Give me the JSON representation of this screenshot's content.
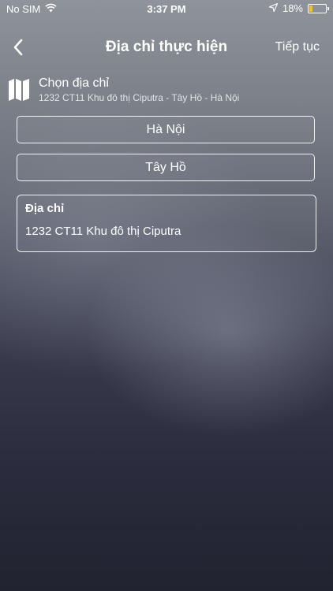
{
  "status_bar": {
    "carrier": "No SIM",
    "time": "3:37 PM",
    "battery_percent": "18%",
    "battery_level": 0.18,
    "icons": [
      "wifi-icon",
      "location-arrow-icon",
      "battery-icon"
    ]
  },
  "nav": {
    "back_icon": "chevron-left-icon",
    "title": "Địa chỉ thực hiện",
    "action_label": "Tiếp tục"
  },
  "chooser": {
    "icon": "map-icon",
    "title": "Chọn địa chỉ",
    "subtitle": "1232 CT11 Khu đô thị Ciputra - Tây Hồ - Hà Nội"
  },
  "fields": {
    "city": "Hà Nội",
    "district": "Tây Hồ"
  },
  "address": {
    "label": "Địa chỉ",
    "value": "1232 CT11 Khu đô thị Ciputra"
  },
  "colors": {
    "battery_fill": "#f3c41b",
    "text": "#ffffff"
  }
}
